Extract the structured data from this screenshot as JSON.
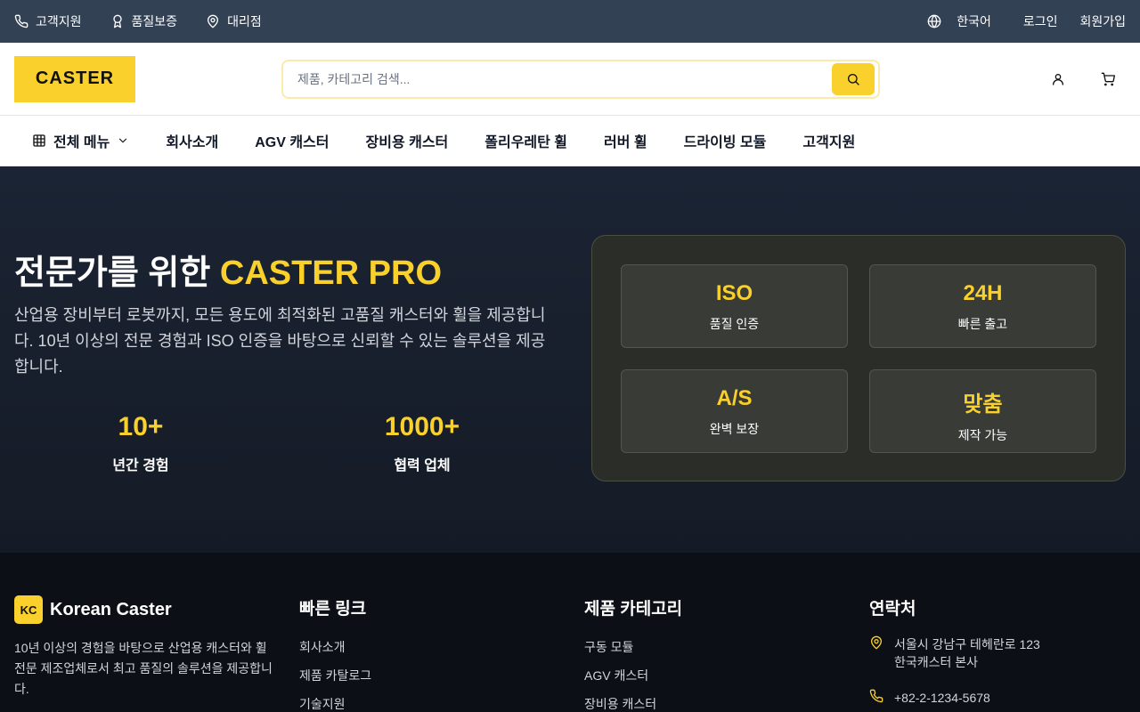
{
  "topbar": {
    "support": "고객지원",
    "quality": "품질보증",
    "dealers": "대리점",
    "language": "한국어",
    "login": "로그인",
    "signup": "회원가입"
  },
  "header": {
    "logo": "CASTER",
    "search_placeholder": "제품, 카테고리 검색..."
  },
  "nav": {
    "all_menu": "전체 메뉴",
    "links": [
      "회사소개",
      "AGV 캐스터",
      "장비용 캐스터",
      "폴리우레탄 휠",
      "러버 휠",
      "드라이빙 모듈",
      "고객지원"
    ]
  },
  "hero": {
    "title_prefix": "전문가를 위한 ",
    "title_highlight": "CASTER PRO",
    "description": "산업용 장비부터 로봇까지, 모든 용도에 최적화된 고품질 캐스터와 휠을 제공합니다. 10년 이상의 전문 경험과 ISO 인증을 바탕으로 신뢰할 수 있는 솔루션을 제공합니다.",
    "stats": [
      {
        "value": "10+",
        "label": "년간 경험"
      },
      {
        "value": "1000+",
        "label": "협력 업체"
      }
    ],
    "cards": [
      {
        "value": "ISO",
        "label": "품질 인증"
      },
      {
        "value": "24H",
        "label": "빠른 출고"
      },
      {
        "value": "A/S",
        "label": "완벽 보장"
      },
      {
        "value": "맞춤",
        "label": "제작 가능"
      }
    ]
  },
  "footer": {
    "brand_badge": "KC",
    "brand_name": "Korean Caster",
    "brand_desc": "10년 이상의 경험을 바탕으로 산업용 캐스터와 휠 전문 제조업체로서 최고 품질의 솔루션을 제공합니다.",
    "quick_links": {
      "title": "빠른 링크",
      "items": [
        "회사소개",
        "제품 카탈로그",
        "기술지원"
      ]
    },
    "categories": {
      "title": "제품 카테고리",
      "items": [
        "구동 모듈",
        "AGV 캐스터",
        "장비용 캐스터"
      ]
    },
    "contact": {
      "title": "연락처",
      "address_line1": "서울시 강남구 테헤란로 123",
      "address_line2": "한국캐스터 본사",
      "phone": "+82-2-1234-5678"
    }
  },
  "colors": {
    "accent": "#fad02c",
    "topbar": "#334155",
    "hero_bg": "#1b2434",
    "footer_bg": "#0c1016"
  }
}
